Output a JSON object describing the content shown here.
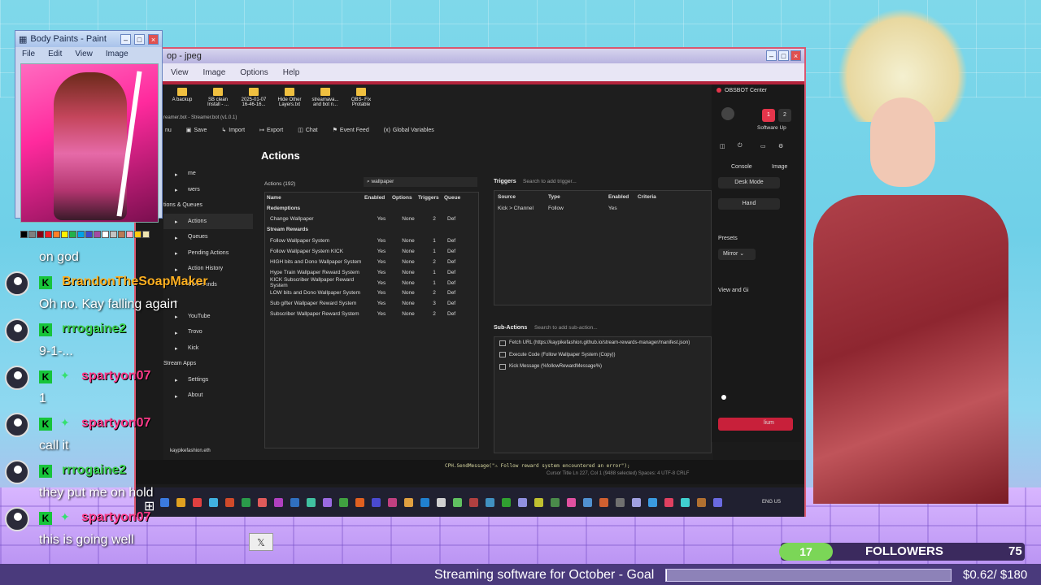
{
  "paint": {
    "title": "Body Paints - Paint",
    "menu": [
      "File",
      "Edit",
      "View",
      "Image"
    ],
    "palette": [
      "#000000",
      "#7f7f7f",
      "#880015",
      "#ed1c24",
      "#ff7f27",
      "#fff200",
      "#22b14c",
      "#00a2e8",
      "#3f48cc",
      "#a349a4",
      "#ffffff",
      "#c3c3c3",
      "#b97a57",
      "#ffaec9",
      "#ffc90e",
      "#efe4b0"
    ]
  },
  "image_viewer": {
    "title": "op - jpeg",
    "menu": [
      "View",
      "Image",
      "Options",
      "Help"
    ]
  },
  "streamerbot": {
    "shortcuts": [
      "A backup",
      "SB clean Install - ...",
      "2025-01-07 16-46-16...",
      "Hide Other Layers.txt",
      "streamava... and bot n...",
      "OBS- Fix Protable"
    ],
    "window_title": "reamer.bot - Streamer.bot (v1.0.1)",
    "toolbar": [
      "nu",
      "Save",
      "Import",
      "Export",
      "Chat",
      "Event Feed",
      "Global Variables"
    ],
    "nav": [
      {
        "label": "me",
        "type": "item"
      },
      {
        "label": "wers",
        "type": "item"
      },
      {
        "label": "tions & Queues",
        "type": "section"
      },
      {
        "label": "Actions",
        "type": "item",
        "active": true
      },
      {
        "label": "Queues",
        "type": "item"
      },
      {
        "label": "Pending Actions",
        "type": "item"
      },
      {
        "label": "Action History",
        "type": "item"
      },
      {
        "label": "Commands",
        "type": "item"
      },
      {
        "label": "",
        "type": "item"
      },
      {
        "label": "YouTube",
        "type": "item"
      },
      {
        "label": "Trovo",
        "type": "item"
      },
      {
        "label": "Kick",
        "type": "item"
      },
      {
        "label": "Stream Apps",
        "type": "section"
      },
      {
        "label": "Settings",
        "type": "item"
      },
      {
        "label": "About",
        "type": "item"
      }
    ],
    "footer_user": "kaypikefashion.eth",
    "page_heading": "Actions",
    "actions_count": "Actions (192)",
    "search_value": "wallpaper",
    "table": {
      "headers": [
        "Name",
        "Enabled",
        "Options",
        "Triggers",
        "Queue"
      ],
      "groups": [
        {
          "name": "Redemptions",
          "rows": [
            [
              "Change Wallpaper",
              "Yes",
              "None",
              "2",
              "Def"
            ]
          ]
        },
        {
          "name": "Stream Rewards",
          "rows": [
            [
              "Follow Wallpaper System",
              "Yes",
              "None",
              "1",
              "Def"
            ],
            [
              "Follow Wallpaper System KICK",
              "Yes",
              "None",
              "1",
              "Def"
            ],
            [
              "HIGH bits and Dono Wallpaper System",
              "Yes",
              "None",
              "2",
              "Def"
            ],
            [
              "Hype Train Wallpaper Reward System",
              "Yes",
              "None",
              "1",
              "Def"
            ],
            [
              "KICK Subscriber Wallpaper Reward System",
              "Yes",
              "None",
              "1",
              "Def"
            ],
            [
              "LOW bits and Dono Wallpaper System",
              "Yes",
              "None",
              "2",
              "Def"
            ],
            [
              "Sub gifter Wallpaper Reward System",
              "Yes",
              "None",
              "3",
              "Def"
            ],
            [
              "Subscriber Wallpaper Reward System",
              "Yes",
              "None",
              "2",
              "Def"
            ]
          ]
        }
      ]
    },
    "triggers": {
      "label": "Triggers",
      "search_placeholder": "Search to add trigger...",
      "headers": [
        "Source",
        "Type",
        "Enabled",
        "Criteria"
      ],
      "rows": [
        [
          "Kick > Channel",
          "Follow",
          "Yes",
          ""
        ]
      ]
    },
    "sub_actions": {
      "label": "Sub-Actions",
      "search_placeholder": "Search to add sub-action...",
      "items": [
        "Fetch URL (https://kaypikefashion.github.io/stream-rewards-manager/manifest.json)",
        "Execute Code (Follow Wallpaper System (Copy))",
        "Kick Message (%followRewardMessage%)"
      ]
    },
    "code_line": "CPH.SendMessage(\"⚠ Follow reward system encountered an error\");",
    "code_status": "Cursor Title    Ln 227, Col 1 (9488 selected)    Spaces: 4    UTF-8    CRLF"
  },
  "obsbot": {
    "title": "OBSBOT Center",
    "tabs": [
      "1",
      "2"
    ],
    "software_update": "Software Up",
    "subtabs": [
      "Console",
      "Image"
    ],
    "desk_mode": "Desk Mode",
    "hand": "Hand",
    "presets_label": "Presets",
    "mirror_value": "Mirror",
    "view_label": "View and Gi",
    "bottom_label": "lium"
  },
  "taskbar": {
    "lang": "ENG US",
    "icon_colors": [
      "#3b7ae0",
      "#e0a020",
      "#e04040",
      "#40b0e0",
      "#d04a2a",
      "#2a9a4a",
      "#e05a5a",
      "#b040c0",
      "#3070c0",
      "#40c0a0",
      "#9a6ae0",
      "#40a040",
      "#e06020",
      "#4a4ad0",
      "#c04080",
      "#e0a040",
      "#2080d0",
      "#d0d0d0",
      "#60c060",
      "#b04040",
      "#4090c0",
      "#30a030",
      "#9090e0",
      "#c0c030",
      "#4a8a4a",
      "#e050a0",
      "#5090d0",
      "#d06030",
      "#707070",
      "#a0a0e0",
      "#3a9ae0",
      "#e04060",
      "#40d0d0",
      "#b07030",
      "#6a6ae0"
    ]
  },
  "chat": [
    {
      "type": "message",
      "text": "on god"
    },
    {
      "type": "user",
      "name": "BrandonTheSoapMaker",
      "color": "#ffb020",
      "badges": [
        "K"
      ]
    },
    {
      "type": "message",
      "text": "Oh no. Kay falling again"
    },
    {
      "type": "user",
      "name": "rrrogaine2",
      "color": "#37d04a",
      "badges": [
        "K"
      ]
    },
    {
      "type": "message",
      "text": "9-1-..."
    },
    {
      "type": "user",
      "name": "spartyon07",
      "color": "#ff3a8a",
      "badges": [
        "K",
        "star"
      ]
    },
    {
      "type": "message",
      "text": "1"
    },
    {
      "type": "user",
      "name": "spartyon07",
      "color": "#ff3a8a",
      "badges": [
        "K",
        "star"
      ]
    },
    {
      "type": "message",
      "text": "call it"
    },
    {
      "type": "user",
      "name": "rrrogaine2",
      "color": "#37d04a",
      "badges": [
        "K"
      ]
    },
    {
      "type": "message",
      "text": "they put me on hold"
    },
    {
      "type": "user",
      "name": "spartyon07",
      "color": "#ff3a8a",
      "badges": [
        "K",
        "star"
      ]
    },
    {
      "type": "message",
      "text": "this is going well"
    }
  ],
  "overlay": {
    "followers_count": "17",
    "followers_label": "FOLLOWERS",
    "followers_goal": "75",
    "followers_progress": 0.2267,
    "goal_text": "Streaming software for October - Goal",
    "goal_amount": "$0.62/ $180",
    "goal_progress": 0.0034
  }
}
